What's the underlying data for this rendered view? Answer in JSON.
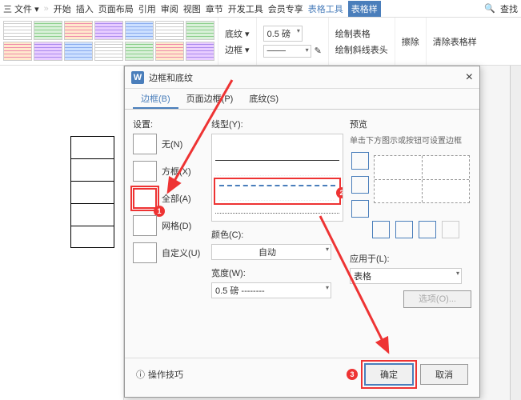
{
  "topbar": {
    "menu": "三 文件 ▾",
    "tabs": [
      "开始",
      "插入",
      "页面布局",
      "引用",
      "审阅",
      "视图",
      "章节",
      "开发工具",
      "会员专享",
      "表格工具",
      "表格样"
    ],
    "search": "查找"
  },
  "ribbon": {
    "shading": "底纹 ▾",
    "border": "边框 ▾",
    "width_val": "0.5",
    "width_unit": "磅",
    "pen": "✎",
    "draw_table": "绘制表格",
    "draw_diag": "绘制斜线表头",
    "eraser": "擦除",
    "clear_style": "清除表格样"
  },
  "dialog": {
    "title": "边框和底纹",
    "close": "×",
    "tabs": {
      "border": "边框(B)",
      "page": "页面边框(P)",
      "shading": "底纹(S)"
    },
    "settings": {
      "label": "设置:",
      "none": "无(N)",
      "box": "方框(X)",
      "all": "全部(A)",
      "grid": "网格(D)",
      "custom": "自定义(U)"
    },
    "line": {
      "label": "线型(Y):"
    },
    "color": {
      "label": "颜色(C):",
      "value": "自动"
    },
    "width": {
      "label": "宽度(W):",
      "value": "0.5 磅 --------"
    },
    "preview": {
      "label": "预览",
      "hint": "单击下方图示或按钮可设置边框"
    },
    "apply": {
      "label": "应用于(L):",
      "value": "表格"
    },
    "options": "选项(O)...",
    "tips": "操作技巧",
    "ok": "确定",
    "cancel": "取消"
  },
  "badges": {
    "b1": "1",
    "b2": "2",
    "b3": "3"
  }
}
